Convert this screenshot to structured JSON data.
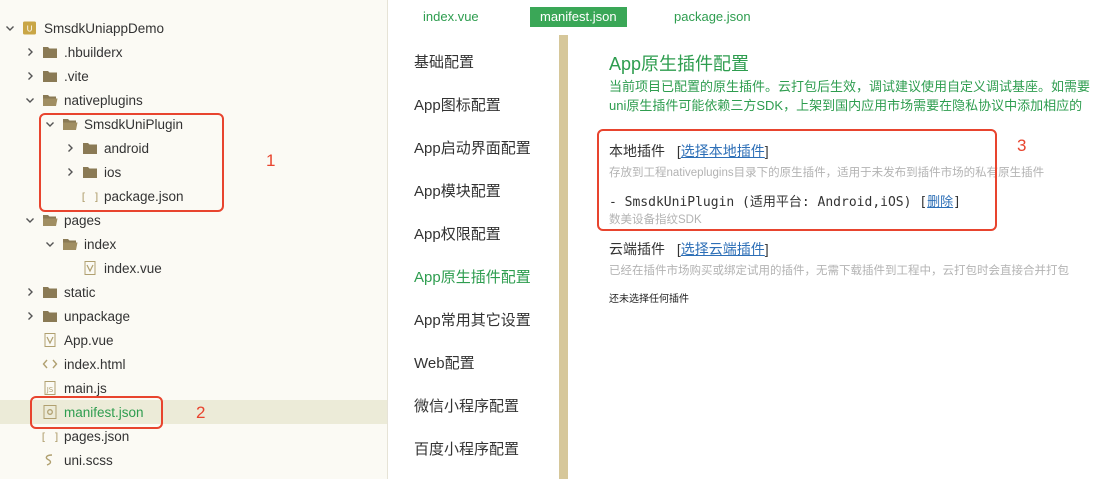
{
  "tree": {
    "items": [
      {
        "label": "SmsdkUniappDemo",
        "icon": "project-icon",
        "chevron": "down"
      },
      {
        "label": ".hbuilderx",
        "icon": "folder-icon",
        "chevron": "right"
      },
      {
        "label": ".vite",
        "icon": "folder-icon",
        "chevron": "right"
      },
      {
        "label": "nativeplugins",
        "icon": "folder-open-icon",
        "chevron": "down"
      },
      {
        "label": "SmsdkUniPlugin",
        "icon": "folder-open-icon",
        "chevron": "down"
      },
      {
        "label": "android",
        "icon": "folder-icon",
        "chevron": "right"
      },
      {
        "label": "ios",
        "icon": "folder-icon",
        "chevron": "right"
      },
      {
        "label": "package.json",
        "icon": "json-file-icon",
        "chevron": ""
      },
      {
        "label": "pages",
        "icon": "folder-open-icon",
        "chevron": "down"
      },
      {
        "label": "index",
        "icon": "folder-open-icon",
        "chevron": "down"
      },
      {
        "label": "index.vue",
        "icon": "vue-file-icon",
        "chevron": ""
      },
      {
        "label": "static",
        "icon": "folder-icon",
        "chevron": "right"
      },
      {
        "label": "unpackage",
        "icon": "folder-icon",
        "chevron": "right"
      },
      {
        "label": "App.vue",
        "icon": "vue-file-icon",
        "chevron": ""
      },
      {
        "label": "index.html",
        "icon": "html-file-icon",
        "chevron": ""
      },
      {
        "label": "main.js",
        "icon": "js-file-icon",
        "chevron": ""
      },
      {
        "label": "manifest.json",
        "icon": "manifest-file-icon",
        "chevron": "",
        "active": true
      },
      {
        "label": "pages.json",
        "icon": "json-file-icon",
        "chevron": ""
      },
      {
        "label": "uni.scss",
        "icon": "scss-file-icon",
        "chevron": ""
      }
    ]
  },
  "tabs": [
    {
      "label": "index.vue"
    },
    {
      "label": "manifest.json",
      "active": true
    },
    {
      "label": "package.json"
    }
  ],
  "menu": [
    {
      "label": "基础配置"
    },
    {
      "label": "App图标配置"
    },
    {
      "label": "App启动界面配置"
    },
    {
      "label": "App模块配置"
    },
    {
      "label": "App权限配置"
    },
    {
      "label": "App原生插件配置",
      "active": true
    },
    {
      "label": "App常用其它设置"
    },
    {
      "label": "Web配置"
    },
    {
      "label": "微信小程序配置"
    },
    {
      "label": "百度小程序配置"
    }
  ],
  "main": {
    "title": "App原生插件配置",
    "desc_line1": "当前项目已配置的原生插件。云打包后生效，调试建议使用自定义调试基座。如需要",
    "desc_line2": "uni原生插件可能依赖三方SDK，上架到国内应用市场需要在隐私协议中添加相应的",
    "local": {
      "heading": "本地插件",
      "bracket_open": "[",
      "link": "选择本地插件",
      "bracket_close": "]",
      "hint": "存放到工程nativeplugins目录下的原生插件，适用于未发布到插件市场的私有原生插件",
      "plugin_entry": "- SmsdkUniPlugin (适用平台: Android,iOS) [",
      "delete_link": "删除",
      "entry_close": "]",
      "plugin_desc": "数美设备指纹SDK"
    },
    "cloud": {
      "heading": "云端插件",
      "bracket_open": "[",
      "link": "选择云端插件",
      "bracket_close": "]",
      "hint": "已经在插件市场购买或绑定试用的插件，无需下载插件到工程中，云打包时会直接合并打包",
      "empty": "还未选择任何插件"
    }
  },
  "annotations": {
    "n1": "1",
    "n2": "2",
    "n3": "3",
    "color": "#e8442e"
  },
  "colors": {
    "accent_green": "#2e9d4f",
    "tab_active_bg": "#3aa757",
    "link_blue": "#2d6fb7"
  }
}
